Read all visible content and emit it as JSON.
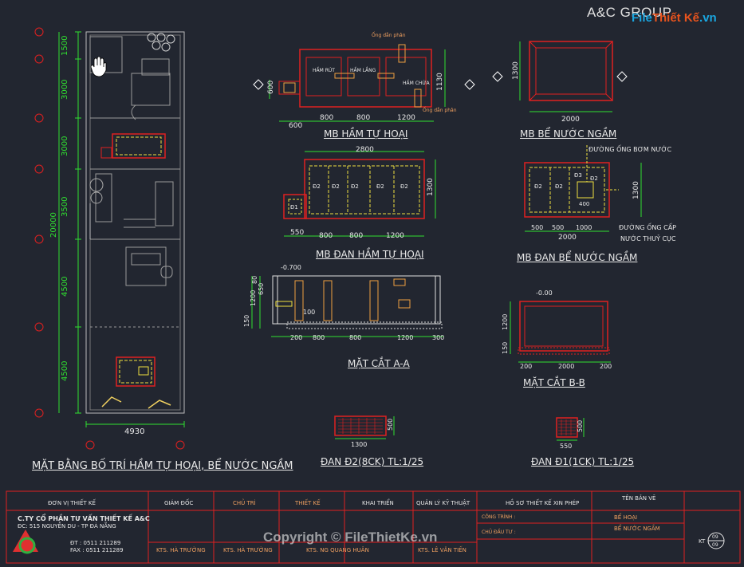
{
  "header": {
    "brand": "A&C GROUP",
    "watermark_logo_a": "File",
    "watermark_logo_b": "Thiết Kế",
    "watermark_logo_c": ".vn"
  },
  "plan": {
    "dims_left": [
      "1500",
      "3000",
      "3000",
      "3500",
      "4500",
      "4500"
    ],
    "total": "20000",
    "width": "4930",
    "title": "MẶT BẰNG BỐ TRÍ HẦM TỰ HOẠI, BỂ NƯỚC NGẦM"
  },
  "sections": {
    "mb_ham": {
      "title": "MB HẦM TỰ HOẠI",
      "labels": [
        "HẦM RÚT",
        "HẦM LẮNG",
        "HẦM CHỨA"
      ],
      "dims": [
        "600",
        "800",
        "800",
        "1200"
      ],
      "height": "1130",
      "side": "600",
      "note_top": "Ống dẫn phân",
      "note_bot": "Ống dẫn phân"
    },
    "mb_be": {
      "title": "MB BỂ NƯỚC NGẦM",
      "dims": [
        "2000"
      ],
      "height": "1300"
    },
    "mb_dan_ham": {
      "title": "MB ĐAN HẦM TỰ HOẠI",
      "top": "2800",
      "labels": [
        "Đ2",
        "Đ2",
        "Đ2",
        "Đ2",
        "Đ2",
        "Đ1"
      ],
      "dims": [
        "550",
        "800",
        "800",
        "1200"
      ],
      "height": "1300"
    },
    "mb_dan_be": {
      "title": "MB ĐAN BỂ NƯỚC NGẦM",
      "labels": [
        "Đ2",
        "Đ2",
        "Đ3",
        "Đ2"
      ],
      "dims": [
        "500",
        "500",
        "1000"
      ],
      "total": "2000",
      "height": "1300",
      "inner": "400",
      "note_1": "ĐƯỜNG ỐNG BƠM NƯỚC",
      "note_2": "ĐƯỜNG ỐNG CẤP",
      "note_3": "NƯỚC THUỶ CỤC"
    },
    "cat_aa": {
      "title": "MẶT CẮT A-A",
      "dims": [
        "200",
        "800",
        "800",
        "1200",
        "300"
      ],
      "level": "-0.700",
      "left_dims": [
        "80",
        "650",
        "1200",
        "150"
      ],
      "mid": "100"
    },
    "cat_bb": {
      "title": "MẶT CẮT B-B",
      "level": "-0.00",
      "dims": [
        "200",
        "2000",
        "200"
      ],
      "left_dims": [
        "1200",
        "150"
      ]
    },
    "dan_d2": {
      "title": "ĐAN Đ2(8CK) TL:1/25",
      "dim": "1300",
      "h": "500"
    },
    "dan_d1": {
      "title": "ĐAN Đ1(1CK) TL:1/25",
      "dim": "550",
      "h": "500"
    }
  },
  "titleblock": {
    "unit_label": "ĐƠN VỊ THIẾT KẾ",
    "company": "C.TY CỔ PHẦN TƯ VẤN THIẾT KẾ A&C",
    "address": "ĐC: 515 NGUYỄN DU - TP ĐÀ NẴNG",
    "phone": "ĐT : 0511 211289",
    "fax": "FAX : 0511 211289",
    "cols": [
      "GIÁM ĐỐC",
      "CHỦ TRÌ",
      "THIẾT KẾ",
      "KHAI TRIỂN",
      "QUẢN LÝ KỸ THUẬT",
      "HỒ SƠ THIẾT KẾ XIN PHÉP",
      "TÊN BẢN VẼ"
    ],
    "names": [
      "KTS. HÀ TRƯỜNG",
      "KTS. HÀ TRƯỜNG",
      "KTS. NG QUANG HUÂN",
      "KTS. LÊ VĂN TIẾN"
    ],
    "project_1": "CÔNG TRÌNH :",
    "project_2": "CHỦ ĐẦU TƯ :",
    "sheet_1": "BỂ HOẠI",
    "sheet_2": "BỂ NƯỚC NGẦM",
    "kt": "KT",
    "page": "09",
    "copyright": "Copyright © FileThietKe.vn"
  },
  "colors": {
    "background": "#222630",
    "red": "#e02020",
    "green": "#30e030",
    "yellow": "#f0e040"
  }
}
